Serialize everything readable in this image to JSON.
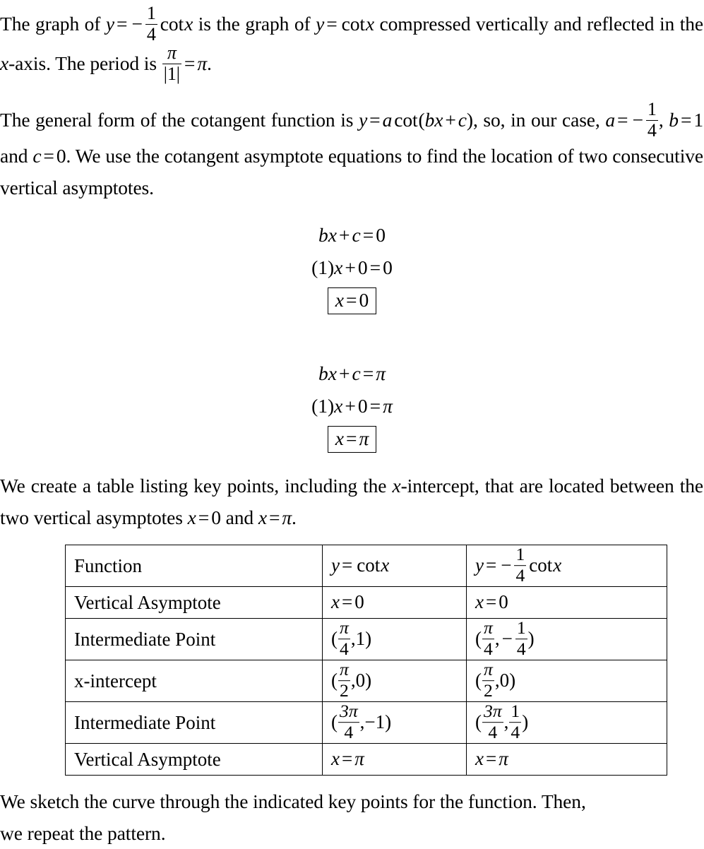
{
  "document": {
    "type": "math-solution",
    "font_color": "#000000",
    "background": "#ffffff"
  },
  "paragraph1": {
    "seg1": "The graph of ",
    "y1": "y",
    "eq1": "=",
    "minus": "−",
    "frac_num": "1",
    "frac_den": "4",
    "cot1": "cot",
    "x1": "x",
    "seg2": " is the graph of ",
    "y2": "y",
    "eq2": "=",
    "cot2": "cot",
    "x2": "x",
    "seg3": " compressed vertically and reflected in the ",
    "x3": "x",
    "seg4": "-axis.  The period is ",
    "period_num": "π",
    "period_den": "|1|",
    "eq3": "=",
    "pi_end": "π",
    "period_end": "."
  },
  "paragraph2": {
    "seg1": "The general form of the cotangent function is ",
    "y": "y",
    "eq1": "=",
    "a1": "a",
    "cot": "cot",
    "paren_open": "(",
    "b1": "b",
    "x1": "x",
    "plus": "+",
    "c1": "c",
    "paren_close": ")",
    "seg2": ", so, in our case, ",
    "a2": "a",
    "eq2": "=",
    "minus": "−",
    "frac_num": "1",
    "frac_den": "4",
    "seg3": ", ",
    "b2": "b",
    "eq3": "=",
    "bval": "1",
    "seg4": " and ",
    "c2": "c",
    "eq4": "=",
    "cval": "0",
    "seg5": ".  We use the cotangent asymptote equations to find the location of two consecutive vertical asymptotes."
  },
  "equation_block_1": {
    "line1": {
      "b": "b",
      "x": "x",
      "plus": "+",
      "c": "c",
      "eq": "=",
      "rhs": "0"
    },
    "line2": {
      "paren_open": "(",
      "one": "1",
      "paren_close": ")",
      "x": "x",
      "plus": "+",
      "zero": "0",
      "eq": "=",
      "rhs": "0"
    },
    "boxed": {
      "x": "x",
      "eq": "=",
      "rhs": "0"
    }
  },
  "equation_block_2": {
    "line1": {
      "b": "b",
      "x": "x",
      "plus": "+",
      "c": "c",
      "eq": "=",
      "rhs": "π"
    },
    "line2": {
      "paren_open": "(",
      "one": "1",
      "paren_close": ")",
      "x": "x",
      "plus": "+",
      "zero": "0",
      "eq": "=",
      "rhs": "π"
    },
    "boxed": {
      "x": "x",
      "eq": "=",
      "rhs": "π"
    }
  },
  "paragraph3": {
    "seg1": "We create a table listing key points, including the ",
    "x1": "x",
    "seg2": "-intercept, that are located between the two vertical asymptotes ",
    "x2": "x",
    "eq1": "=",
    "val1": "0",
    "seg3": " and ",
    "x3": "x",
    "eq2": "=",
    "val2": "π",
    "seg4": "."
  },
  "table": {
    "rows": [
      {
        "label": "Function",
        "col2": {
          "kind": "cot",
          "y": "y",
          "eq": "=",
          "cot": "cot",
          "x": "x"
        },
        "col3": {
          "kind": "scaled-cot",
          "y": "y",
          "eq": "=",
          "minus": "−",
          "num": "1",
          "den": "4",
          "cot": "cot",
          "x": "x"
        },
        "tall": true
      },
      {
        "label": "Vertical Asymptote",
        "col2": {
          "kind": "simple",
          "x": "x",
          "eq": "=",
          "val": "0"
        },
        "col3": {
          "kind": "simple",
          "x": "x",
          "eq": "=",
          "val": "0"
        },
        "tall": false
      },
      {
        "label": "Intermediate Point",
        "col2": {
          "kind": "point-frac-plain",
          "open": "(",
          "num": "π",
          "den": "4",
          "comma": ",",
          "y": "1",
          "close": ")"
        },
        "col3": {
          "kind": "point-frac-frac",
          "open": "(",
          "num": "π",
          "den": "4",
          "comma": ",",
          "sign": "−",
          "ynum": "1",
          "yden": "4",
          "close": ")"
        },
        "tall": true
      },
      {
        "label": "x-intercept",
        "col2": {
          "kind": "point-frac-plain",
          "open": "(",
          "num": "π",
          "den": "2",
          "comma": ",",
          "y": "0",
          "close": ")"
        },
        "col3": {
          "kind": "point-frac-plain",
          "open": "(",
          "num": "π",
          "den": "2",
          "comma": ",",
          "y": "0",
          "close": ")"
        },
        "tall": true
      },
      {
        "label": "Intermediate Point",
        "col2": {
          "kind": "point-frac-plain",
          "open": "(",
          "num": "3π",
          "den": "4",
          "comma": ",",
          "y": "−1",
          "close": ")"
        },
        "col3": {
          "kind": "point-frac-frac",
          "open": "(",
          "num": "3π",
          "den": "4",
          "comma": ",",
          "sign": "",
          "ynum": "1",
          "yden": "4",
          "close": ")"
        },
        "tall": true
      },
      {
        "label": "Vertical Asymptote",
        "col2": {
          "kind": "simple",
          "x": "x",
          "eq": "=",
          "val": "π"
        },
        "col3": {
          "kind": "simple",
          "x": "x",
          "eq": "=",
          "val": "π"
        },
        "tall": false
      }
    ]
  },
  "paragraph4": {
    "line1": "We sketch the curve through the indicated key points for the function.  Then,",
    "line2": "we repeat the pattern."
  }
}
